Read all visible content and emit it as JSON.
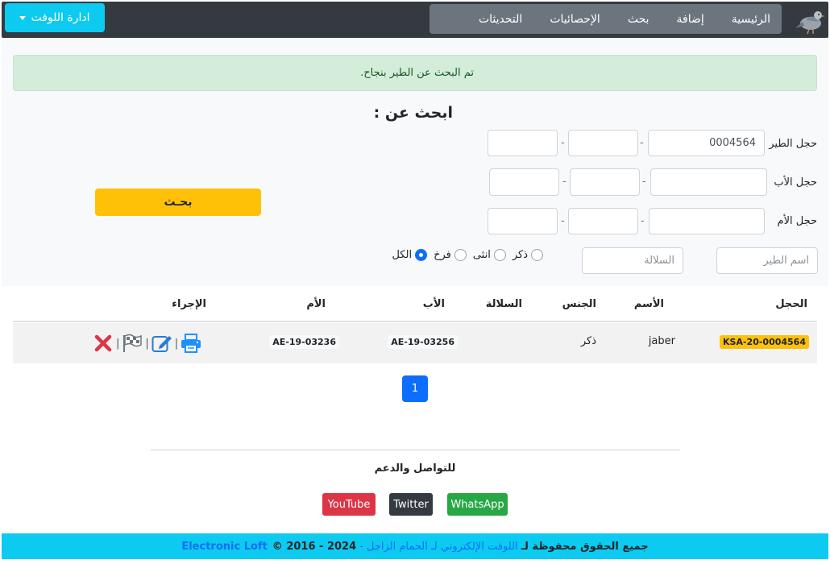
{
  "navbar": {
    "logo_icon": "pigeon-icon",
    "items": [
      {
        "label": "الرئيسية"
      },
      {
        "label": "إضافة"
      },
      {
        "label": "بحث"
      },
      {
        "label": "الإحصائيات"
      },
      {
        "label": "التحديثات"
      }
    ],
    "admin_menu_label": "ادارة اللوفت"
  },
  "alert": {
    "message": "تم البحث عن الطير بنجاح."
  },
  "search": {
    "title": "ابحث عن :",
    "bird_ring_label": "حجل الطير",
    "bird_ring_value": "0004564",
    "father_ring_label": "حجل الأب",
    "mother_ring_label": "حجل الأم",
    "separator": "-",
    "bird_name_placeholder": "اسم الطير",
    "breed_placeholder": "السلالة",
    "gender_options": [
      {
        "label": "ذكر",
        "checked": false
      },
      {
        "label": "انثى",
        "checked": false
      },
      {
        "label": "فرخ",
        "checked": false
      },
      {
        "label": "الكل",
        "checked": true
      }
    ],
    "search_button_label": "بحـث"
  },
  "table": {
    "headers": [
      "الحجل",
      "الأسم",
      "الجنس",
      "السلالة",
      "الأب",
      "الأم",
      "الإجراء"
    ],
    "rows": [
      {
        "ring": "KSA-20-0004564",
        "name": "jaber",
        "gender": "ذكر",
        "breed": "",
        "father": "AE-19-03256",
        "mother": "AE-19-03236",
        "action_icons": [
          "print-icon",
          "edit-icon",
          "flag-icon",
          "delete-icon"
        ],
        "action_separator": "|"
      }
    ]
  },
  "pagination": {
    "current_page": "1"
  },
  "footer": {
    "support_title": "للتواصل والدعم",
    "youtube_label": "YouTube",
    "twitter_label": "Twitter",
    "whatsapp_label": "WhatsApp",
    "rights_prefix": "جميع الحقوق محفوظة لـ",
    "rights_name": "اللوفت الإلكتروني لـ الحمام الزاجل -",
    "years": "2024 - 2016 ©",
    "site_link": "Electronic Loft"
  },
  "colors": {
    "navbar_bg": "#343a40",
    "nav_menu_bg": "#6c757d",
    "admin_btn": "#0dcaf0",
    "alert_bg": "#d4edda",
    "search_btn": "#ffc107",
    "ring_badge": "#ffc107",
    "page_btn": "#0d6efd",
    "youtube": "#dc3545",
    "twitter": "#343a40",
    "whatsapp": "#28a745",
    "footer_bar": "#0dcaf0"
  }
}
